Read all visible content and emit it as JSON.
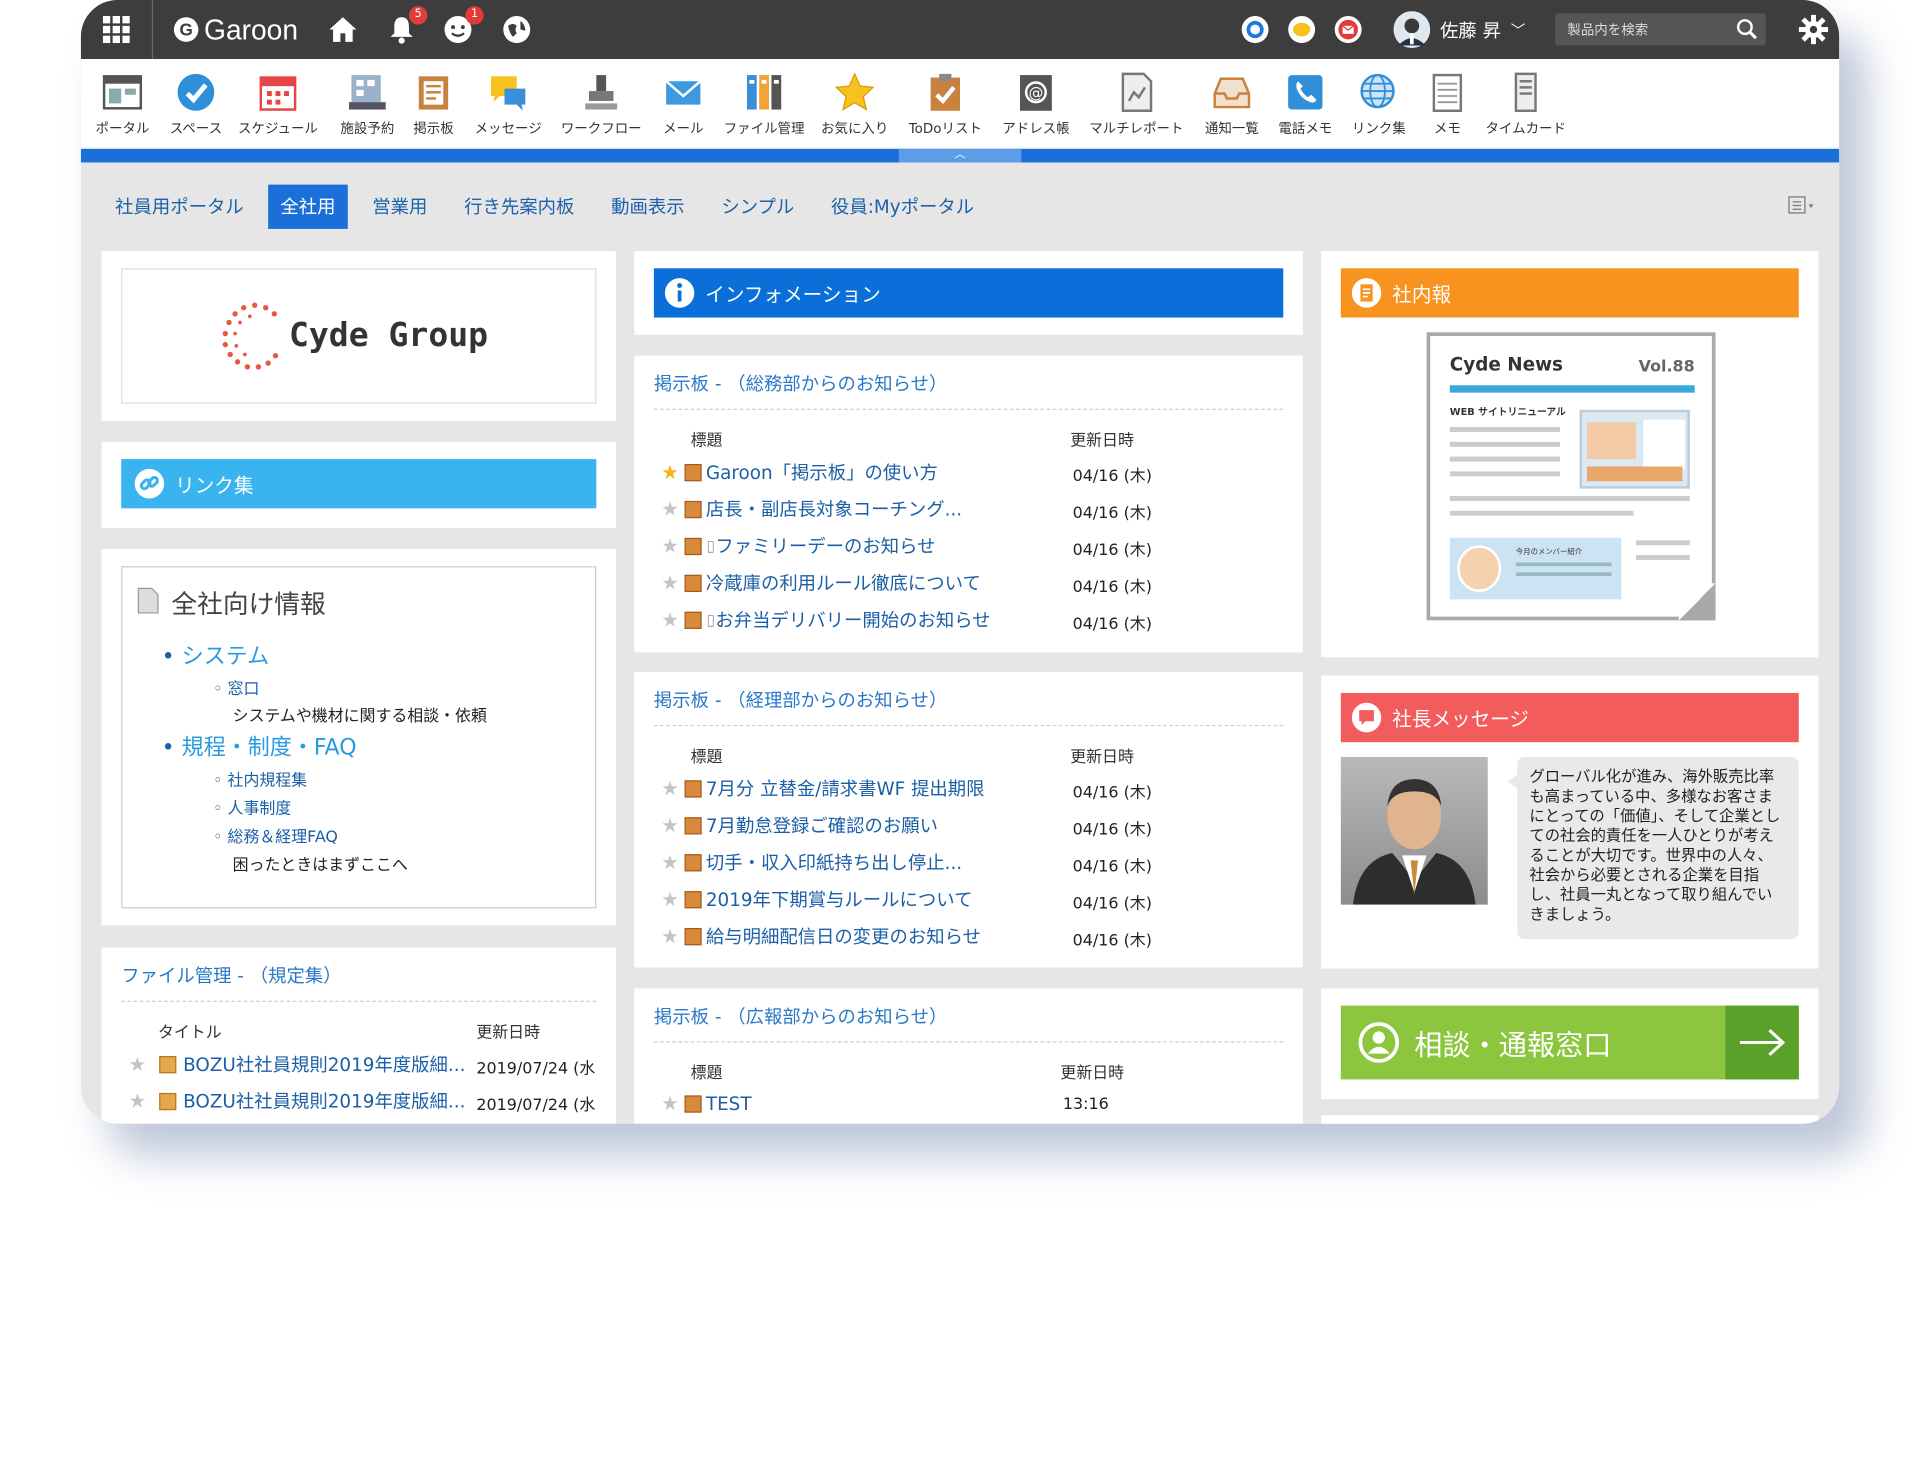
{
  "top": {
    "app_name": "Garoon",
    "bell_badge": "5",
    "face_badge": "1",
    "user_name": "佐藤 昇",
    "search_placeholder": "製品内を検索"
  },
  "apps": [
    {
      "label": "ポータル",
      "icon": "portal-icon"
    },
    {
      "label": "スペース",
      "icon": "space-icon"
    },
    {
      "label": "スケジュール",
      "icon": "calendar-icon"
    },
    {
      "label": "施設予約",
      "icon": "facility-icon"
    },
    {
      "label": "掲示板",
      "icon": "bulletin-icon"
    },
    {
      "label": "メッセージ",
      "icon": "message-icon"
    },
    {
      "label": "ワークフロー",
      "icon": "stamp-icon"
    },
    {
      "label": "メール",
      "icon": "mail-icon"
    },
    {
      "label": "ファイル管理",
      "icon": "file-icon"
    },
    {
      "label": "お気に入り",
      "icon": "star-icon"
    },
    {
      "label": "ToDoリスト",
      "icon": "todo-icon"
    },
    {
      "label": "アドレス帳",
      "icon": "address-icon"
    },
    {
      "label": "マルチレポート",
      "icon": "report-icon"
    },
    {
      "label": "通知一覧",
      "icon": "inbox-icon"
    },
    {
      "label": "電話メモ",
      "icon": "phone-icon"
    },
    {
      "label": "リンク集",
      "icon": "globe-icon"
    },
    {
      "label": "メモ",
      "icon": "memo-icon"
    },
    {
      "label": "タイムカード",
      "icon": "timecard-icon"
    }
  ],
  "tabs": [
    "社員用ポータル",
    "全社用",
    "営業用",
    "行き先案内板",
    "動画表示",
    "シンプル",
    "役員:Myポータル"
  ],
  "left": {
    "logo_text": "Cyde Group",
    "link_header": "リンク集",
    "info_title": "全社向け情報",
    "sys": "システム",
    "sys_sub": "窓口",
    "sys_desc": "システムや機材に関する相談・依頼",
    "rules": "規程・制度・FAQ",
    "r1": "社内規程集",
    "r2": "人事制度",
    "r3": "総務＆経理FAQ",
    "r3_desc": "困ったときはまずここへ",
    "file_title": "ファイル管理 - （規定集）",
    "file_col1": "タイトル",
    "file_col2": "更新日時",
    "files": [
      {
        "t": "BOZU社社員規則2019年度版細...",
        "d": "2019/07/24 (水"
      },
      {
        "t": "BOZU社社員規則2019年度版細...",
        "d": "2019/07/24 (水"
      }
    ]
  },
  "center": {
    "info_header": "インフォメーション",
    "col_title": "標題",
    "col_date": "更新日時",
    "b1_title": "掲示板 - （総務部からのお知らせ）",
    "b1": [
      {
        "t": "Garoon「掲示板」の使い方",
        "d": "04/16 (木)"
      },
      {
        "t": "店長・副店長対象コーチング...",
        "d": "04/16 (木)"
      },
      {
        "t": "ファミリーデーのお知らせ",
        "d": "04/16 (木)"
      },
      {
        "t": "冷蔵庫の利用ルール徹底について",
        "d": "04/16 (木)"
      },
      {
        "t": "お弁当デリバリー開始のお知らせ",
        "d": "04/16 (木)"
      }
    ],
    "b2_title": "掲示板 - （経理部からのお知らせ）",
    "b2": [
      {
        "t": "7月分 立替金/請求書WF 提出期限",
        "d": "04/16 (木)"
      },
      {
        "t": "7月勤怠登録ご確認のお願い",
        "d": "04/16 (木)"
      },
      {
        "t": "切手・収入印紙持ち出し停止...",
        "d": "04/16 (木)"
      },
      {
        "t": "2019年下期賞与ルールについて",
        "d": "04/16 (木)"
      },
      {
        "t": "給与明細配信日の変更のお知らせ",
        "d": "04/16 (木)"
      }
    ],
    "b3_title": "掲示板 - （広報部からのお知らせ）",
    "b3": [
      {
        "t": "TEST",
        "d": "13:16"
      }
    ]
  },
  "right": {
    "news_header": "社内報",
    "news_title": "Cyde News",
    "news_vol": "Vol.88",
    "news_sub": "WEB サイトリニューアル",
    "news_member": "今月のメンバー紹介",
    "ceo_header": "社長メッセージ",
    "ceo_msg": "グローバル化が進み、海外販売比率も高まっている中、多様なお客さまにとっての「価値」、そして企業としての社会的責任を一人ひとりが考えることが大切です。世界中の人々、社会から必要とされる企業を目指し、社員一丸となって取り組んでいきましょう。",
    "consult": "相談・通報窓口"
  },
  "colors": {
    "blue": "#1a6fd8",
    "cyan": "#3ab4ef",
    "orange": "#f7931e",
    "red": "#f25c5c",
    "green": "#8cc63f",
    "darkgreen": "#5aa12a"
  }
}
